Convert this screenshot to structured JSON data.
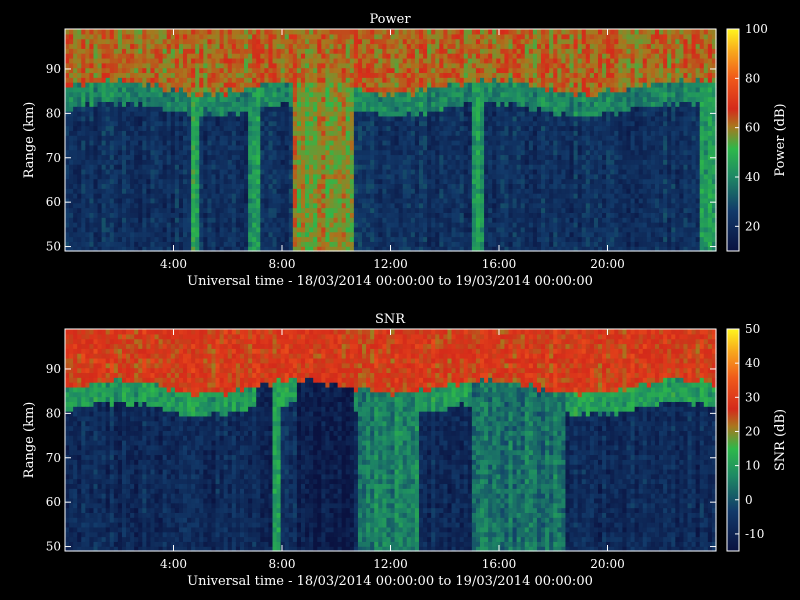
{
  "chart_data": [
    {
      "type": "heatmap",
      "title": "Power",
      "xlabel": "Universal time - 18/03/2014 00:00:00 to 19/03/2014 00:00:00",
      "ylabel": "Range (km)",
      "xlim": [
        0,
        24
      ],
      "ylim": [
        49,
        99
      ],
      "x_tick_values": [
        4,
        8,
        12,
        16,
        20
      ],
      "x_tick_labels": [
        "4:00",
        "8:00",
        "12:00",
        "16:00",
        "20:00"
      ],
      "y_tick_values": [
        50,
        60,
        70,
        80,
        90
      ],
      "y_tick_labels": [
        "50",
        "60",
        "70",
        "80",
        "90"
      ],
      "colorbar": {
        "label": "Power (dB)",
        "range": [
          10,
          100
        ],
        "tick_values": [
          20,
          40,
          60,
          80,
          100
        ],
        "tick_labels": [
          "20",
          "40",
          "60",
          "80",
          "100"
        ]
      },
      "layers_km": [
        {
          "from_km": 49,
          "to_km": 81,
          "value_db": 22
        },
        {
          "from_km": 81,
          "to_km": 86,
          "value_db": 40
        },
        {
          "from_km": 86,
          "to_km": 99,
          "value_db": 62
        }
      ],
      "vertical_stripes_hours": [
        {
          "start": 4.6,
          "end": 5.0,
          "value_db": 48
        },
        {
          "start": 6.8,
          "end": 7.2,
          "value_db": 42
        },
        {
          "start": 8.4,
          "end": 10.6,
          "value_db": 58
        },
        {
          "start": 15.0,
          "end": 15.4,
          "value_db": 44
        },
        {
          "start": 23.4,
          "end": 24.0,
          "value_db": 44
        }
      ]
    },
    {
      "type": "heatmap",
      "title": "SNR",
      "xlabel": "Universal time - 18/03/2014 00:00:00 to 19/03/2014 00:00:00",
      "ylabel": "Range (km)",
      "xlim": [
        0,
        24
      ],
      "ylim": [
        49,
        99
      ],
      "x_tick_values": [
        4,
        8,
        12,
        16,
        20
      ],
      "x_tick_labels": [
        "4:00",
        "8:00",
        "12:00",
        "16:00",
        "20:00"
      ],
      "y_tick_values": [
        50,
        60,
        70,
        80,
        90
      ],
      "y_tick_labels": [
        "50",
        "60",
        "70",
        "80",
        "90"
      ],
      "colorbar": {
        "label": "SNR (dB)",
        "range": [
          -15,
          50
        ],
        "tick_values": [
          -10,
          0,
          10,
          20,
          30,
          40,
          50
        ],
        "tick_labels": [
          "-10",
          "0",
          "10",
          "20",
          "30",
          "40",
          "50"
        ]
      },
      "layers_km": [
        {
          "from_km": 49,
          "to_km": 81,
          "value_db": -8
        },
        {
          "from_km": 81,
          "to_km": 86,
          "value_db": 10
        },
        {
          "from_km": 86,
          "to_km": 99,
          "value_db": 27
        }
      ],
      "vertical_stripes_hours": [
        {
          "start": 7.0,
          "end": 7.6,
          "value_db": -10
        },
        {
          "start": 7.6,
          "end": 8.0,
          "value_db": 12
        },
        {
          "start": 8.6,
          "end": 10.6,
          "value_db": -12
        },
        {
          "start": 10.8,
          "end": 13.0,
          "value_db": 6
        },
        {
          "start": 15.0,
          "end": 18.4,
          "value_db": 4
        }
      ]
    }
  ]
}
